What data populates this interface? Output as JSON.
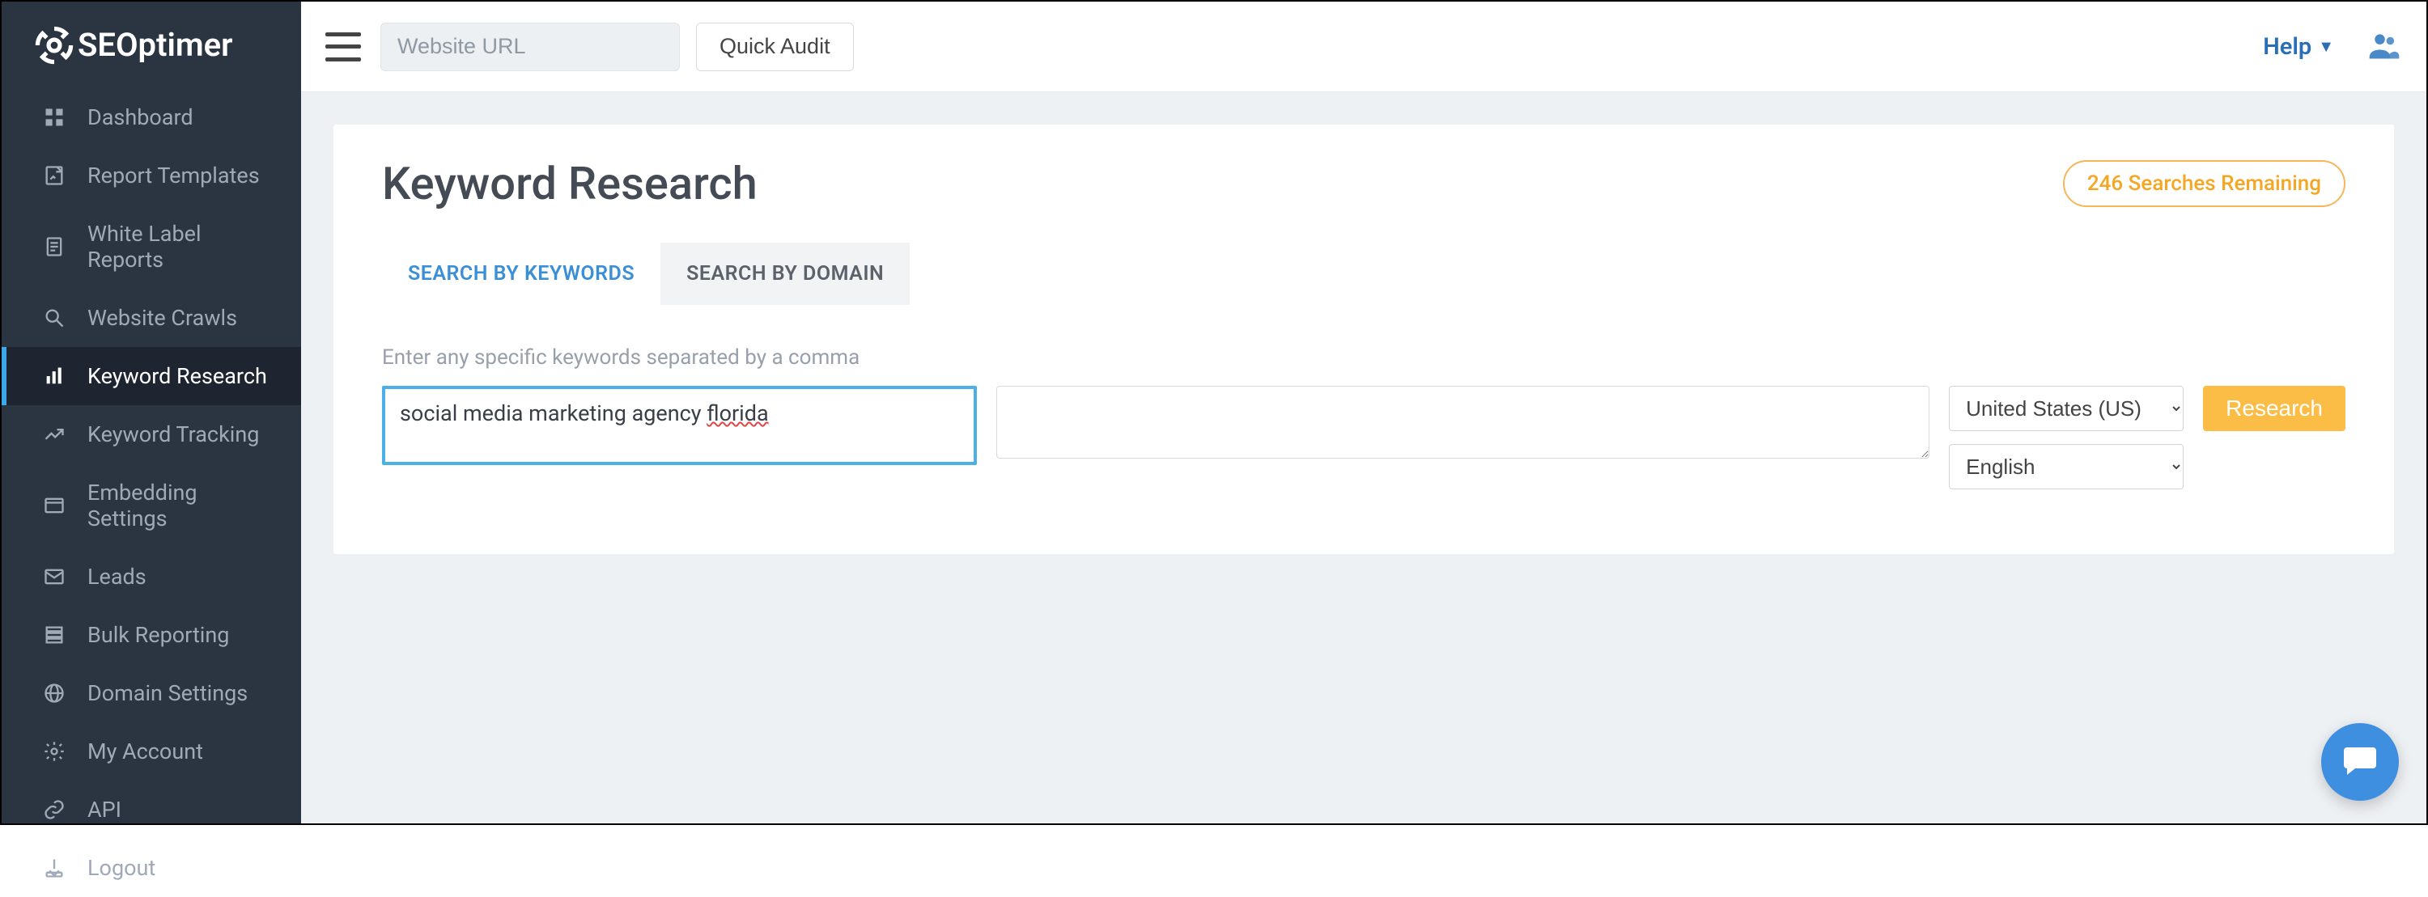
{
  "brand": {
    "name": "SEOptimer"
  },
  "topbar": {
    "url_placeholder": "Website URL",
    "quick_audit": "Quick Audit",
    "help": "Help"
  },
  "sidebar": {
    "items": [
      {
        "label": "Dashboard",
        "icon": "dashboard-icon"
      },
      {
        "label": "Report Templates",
        "icon": "template-icon"
      },
      {
        "label": "White Label Reports",
        "icon": "document-icon"
      },
      {
        "label": "Website Crawls",
        "icon": "magnifier-icon"
      },
      {
        "label": "Keyword Research",
        "icon": "bar-chart-icon",
        "active": true
      },
      {
        "label": "Keyword Tracking",
        "icon": "trend-icon"
      },
      {
        "label": "Embedding Settings",
        "icon": "embed-icon"
      },
      {
        "label": "Leads",
        "icon": "mail-icon"
      },
      {
        "label": "Bulk Reporting",
        "icon": "stack-icon"
      },
      {
        "label": "Domain Settings",
        "icon": "globe-icon"
      },
      {
        "label": "My Account",
        "icon": "gear-icon"
      },
      {
        "label": "API",
        "icon": "link-icon"
      },
      {
        "label": "Logout",
        "icon": "logout-icon"
      }
    ]
  },
  "page": {
    "title": "Keyword Research",
    "searches_remaining": "246 Searches Remaining"
  },
  "tabs": {
    "by_keywords": "SEARCH BY KEYWORDS",
    "by_domain": "SEARCH BY DOMAIN"
  },
  "form": {
    "hint": "Enter any specific keywords separated by a comma",
    "keywords_prefix": "social media marketing agency ",
    "keywords_wavy": "florida",
    "country": "United States (US)",
    "language": "English",
    "research_button": "Research"
  }
}
